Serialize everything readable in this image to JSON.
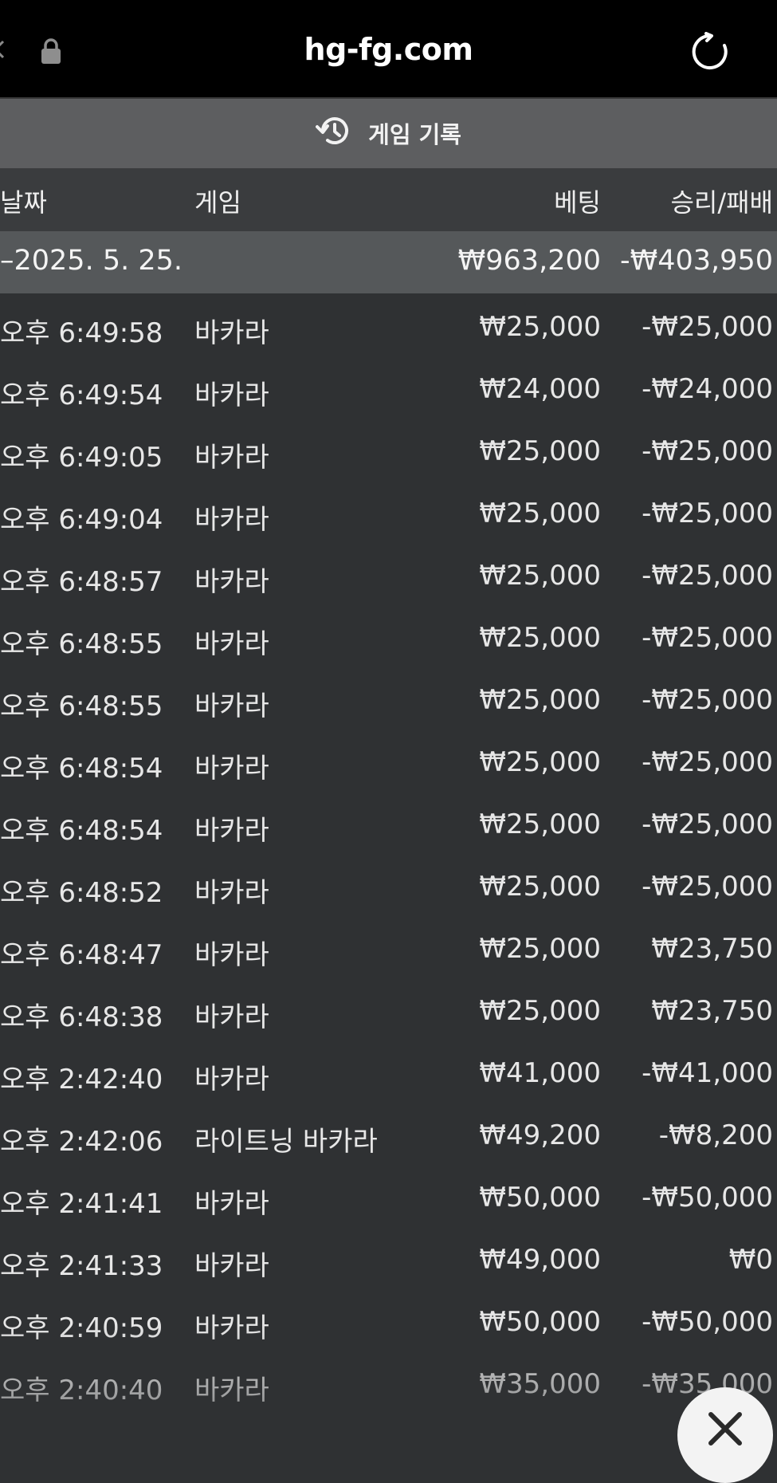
{
  "browser": {
    "url": "hg-fg.com"
  },
  "panel": {
    "title": "게임 기록"
  },
  "table": {
    "headers": {
      "date": "날짜",
      "game": "게임",
      "bet": "베팅",
      "result": "승리/패배"
    },
    "summary": {
      "date": "–2025. 5. 25.",
      "bet": "₩963,200",
      "result": "-₩403,950"
    },
    "rows": [
      {
        "time": "오후 6:49:58",
        "game": "바카라",
        "bet": "₩25,000",
        "result": "-₩25,000"
      },
      {
        "time": "오후 6:49:54",
        "game": "바카라",
        "bet": "₩24,000",
        "result": "-₩24,000"
      },
      {
        "time": "오후 6:49:05",
        "game": "바카라",
        "bet": "₩25,000",
        "result": "-₩25,000"
      },
      {
        "time": "오후 6:49:04",
        "game": "바카라",
        "bet": "₩25,000",
        "result": "-₩25,000"
      },
      {
        "time": "오후 6:48:57",
        "game": "바카라",
        "bet": "₩25,000",
        "result": "-₩25,000"
      },
      {
        "time": "오후 6:48:55",
        "game": "바카라",
        "bet": "₩25,000",
        "result": "-₩25,000"
      },
      {
        "time": "오후 6:48:55",
        "game": "바카라",
        "bet": "₩25,000",
        "result": "-₩25,000"
      },
      {
        "time": "오후 6:48:54",
        "game": "바카라",
        "bet": "₩25,000",
        "result": "-₩25,000"
      },
      {
        "time": "오후 6:48:54",
        "game": "바카라",
        "bet": "₩25,000",
        "result": "-₩25,000"
      },
      {
        "time": "오후 6:48:52",
        "game": "바카라",
        "bet": "₩25,000",
        "result": "-₩25,000"
      },
      {
        "time": "오후 6:48:47",
        "game": "바카라",
        "bet": "₩25,000",
        "result": "₩23,750"
      },
      {
        "time": "오후 6:48:38",
        "game": "바카라",
        "bet": "₩25,000",
        "result": "₩23,750"
      },
      {
        "time": "오후 2:42:40",
        "game": "바카라",
        "bet": "₩41,000",
        "result": "-₩41,000"
      },
      {
        "time": "오후 2:42:06",
        "game": "라이트닝 바카라",
        "bet": "₩49,200",
        "result": "-₩8,200"
      },
      {
        "time": "오후 2:41:41",
        "game": "바카라",
        "bet": "₩50,000",
        "result": "-₩50,000"
      },
      {
        "time": "오후 2:41:33",
        "game": "바카라",
        "bet": "₩49,000",
        "result": "₩0"
      },
      {
        "time": "오후 2:40:59",
        "game": "바카라",
        "bet": "₩50,000",
        "result": "-₩50,000"
      },
      {
        "time": "오후 2:40:40",
        "game": "바카라",
        "bet": "₩35,000",
        "result": "-₩35,000"
      }
    ]
  },
  "icons": {
    "lock": "lock-icon",
    "reload": "reload-icon",
    "history": "history-icon",
    "close": "close-icon"
  }
}
